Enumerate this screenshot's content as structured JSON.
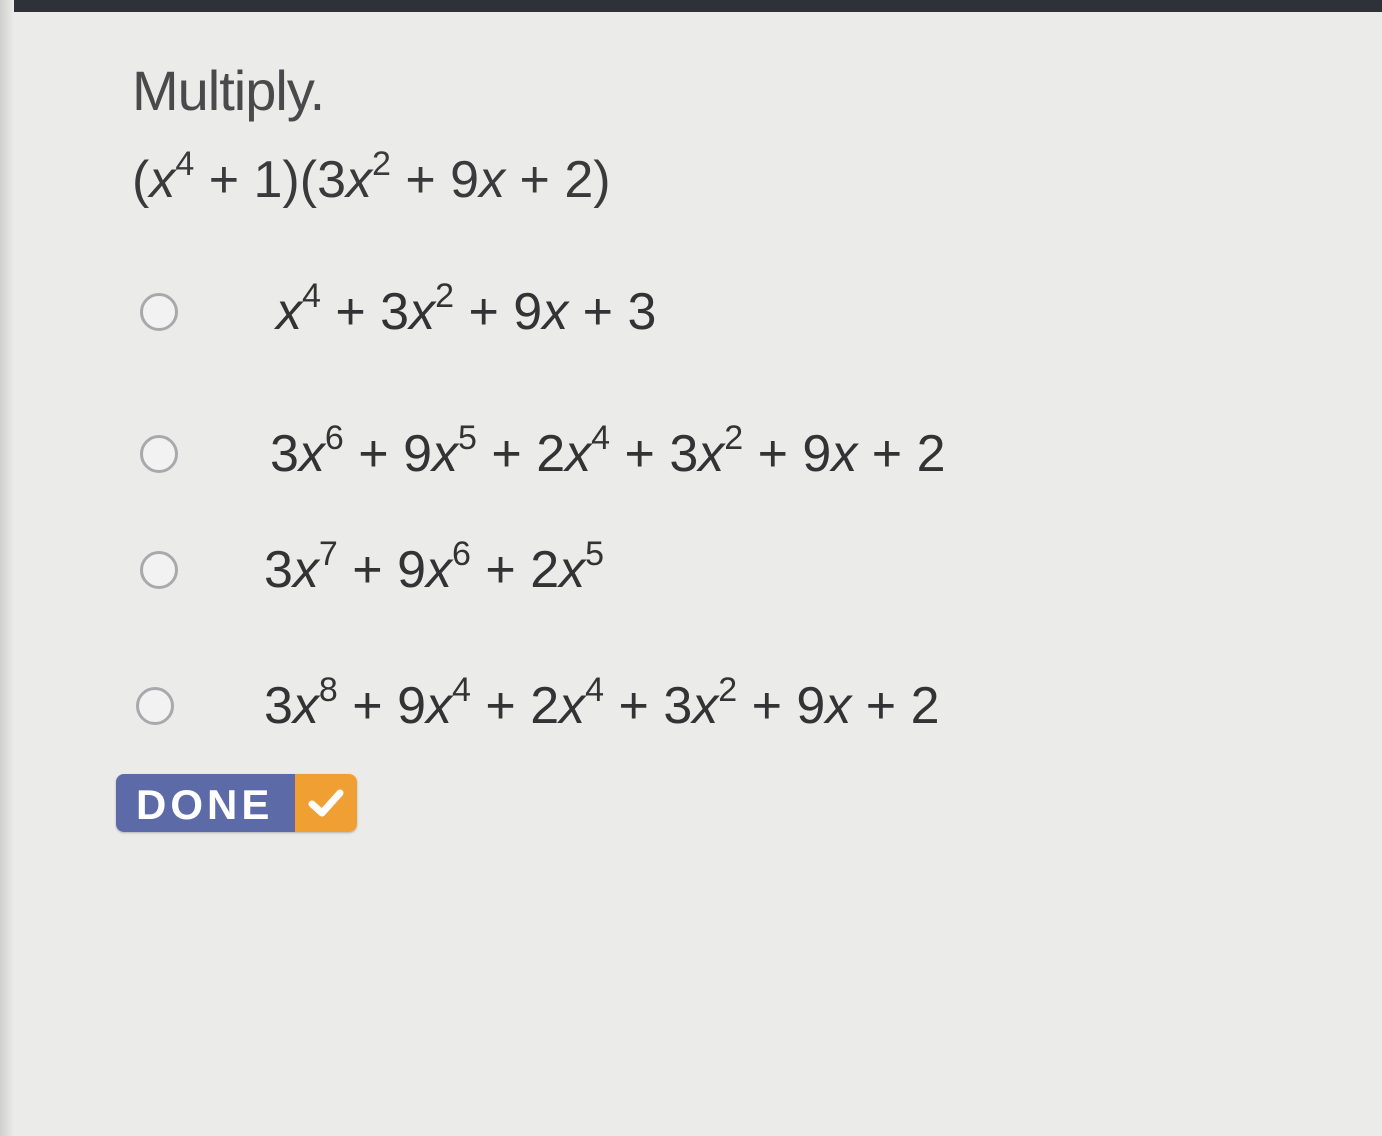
{
  "question": {
    "instruction": "Multiply.",
    "problem": "(x^4 + 1)(3x^2 + 9x + 2)"
  },
  "options": [
    {
      "label": "x^4 + 3x^2 + 9x + 3",
      "selected": false
    },
    {
      "label": "3x^6 + 9x^5 + 2x^4 + 3x^2 + 9x + 2",
      "selected": false
    },
    {
      "label": "3x^7 + 9x^6 + 2x^5",
      "selected": false
    },
    {
      "label": "3x^8 + 9x^4 + 2x^4 + 3x^2 + 9x + 2",
      "selected": false
    }
  ],
  "done_button": {
    "label": "DONE",
    "icon": "check-icon",
    "colors": {
      "label_bg": "#5d6aa8",
      "icon_bg": "#f0a032"
    }
  }
}
